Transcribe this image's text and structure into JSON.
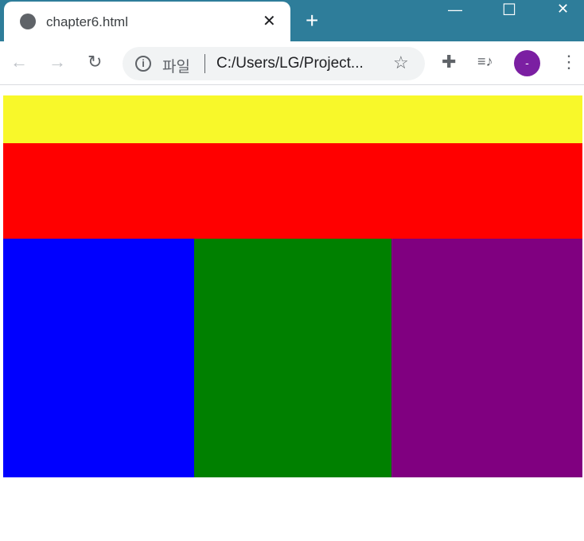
{
  "tab": {
    "title": "chapter6.html",
    "close": "✕"
  },
  "newtab": "+",
  "window": {
    "minimize": "—",
    "maximize": "☐",
    "close": "✕"
  },
  "toolbar": {
    "back": "←",
    "forward": "→",
    "reload": "↻",
    "info": "i",
    "scheme": "파일",
    "url": "C:/Users/LG/Project...",
    "star": "☆",
    "extensions": "✚",
    "media": "≡♪",
    "avatar": "-",
    "menu": "⋮"
  },
  "colors": {
    "header": "#f8f82a",
    "nav": "#ff0000",
    "left": "#0000ff",
    "center": "#008000",
    "right": "#800080"
  }
}
